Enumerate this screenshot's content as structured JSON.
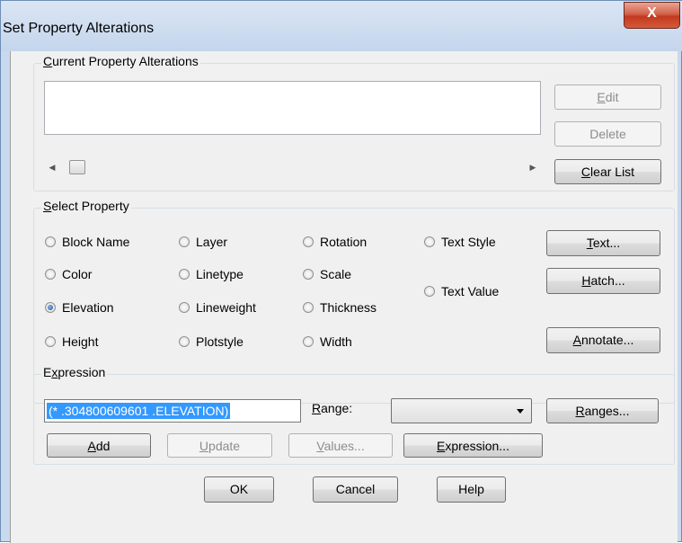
{
  "dialog": {
    "title": "Set Property Alterations",
    "close_glyph": "X"
  },
  "current_group": {
    "legend_mnemonic": "C",
    "legend_rest": "urrent Property Alterations",
    "edit_mnemonic": "E",
    "edit_rest": "dit",
    "delete_label": "Delete",
    "clear_mnemonic": "C",
    "clear_rest": "lear List"
  },
  "select_group": {
    "legend_mnemonic": "S",
    "legend_rest": "elect Property",
    "properties": {
      "block_name": "Block Name",
      "layer": "Layer",
      "rotation": "Rotation",
      "text_style": "Text Style",
      "color": "Color",
      "linetype": "Linetype",
      "scale": "Scale",
      "text_value": "Text Value",
      "elevation": "Elevation",
      "lineweight": "Lineweight",
      "thickness": "Thickness",
      "height": "Height",
      "plotstyle": "Plotstyle",
      "width": "Width"
    },
    "selected": "Elevation",
    "text_mnemonic": "T",
    "text_rest": "ext...",
    "hatch_mnemonic": "H",
    "hatch_rest": "atch...",
    "annotate_mnemonic": "A",
    "annotate_rest": "nnotate..."
  },
  "expression_group": {
    "legend_pre": "E",
    "legend_mnemonic": "x",
    "legend_rest": "pression",
    "value": "(* .304800609601 .ELEVATION)",
    "range_mnemonic": "R",
    "range_rest": "ange:",
    "range_value": "",
    "ranges_mnemonic": "R",
    "ranges_rest": "anges...",
    "add_mnemonic": "A",
    "add_rest": "dd",
    "update_mnemonic": "U",
    "update_rest": "pdate",
    "values_mnemonic": "V",
    "values_rest": "alues...",
    "expression_mnemonic": "E",
    "expression_rest": "xpression..."
  },
  "footer": {
    "ok": "OK",
    "cancel": "Cancel",
    "help": "Help"
  }
}
